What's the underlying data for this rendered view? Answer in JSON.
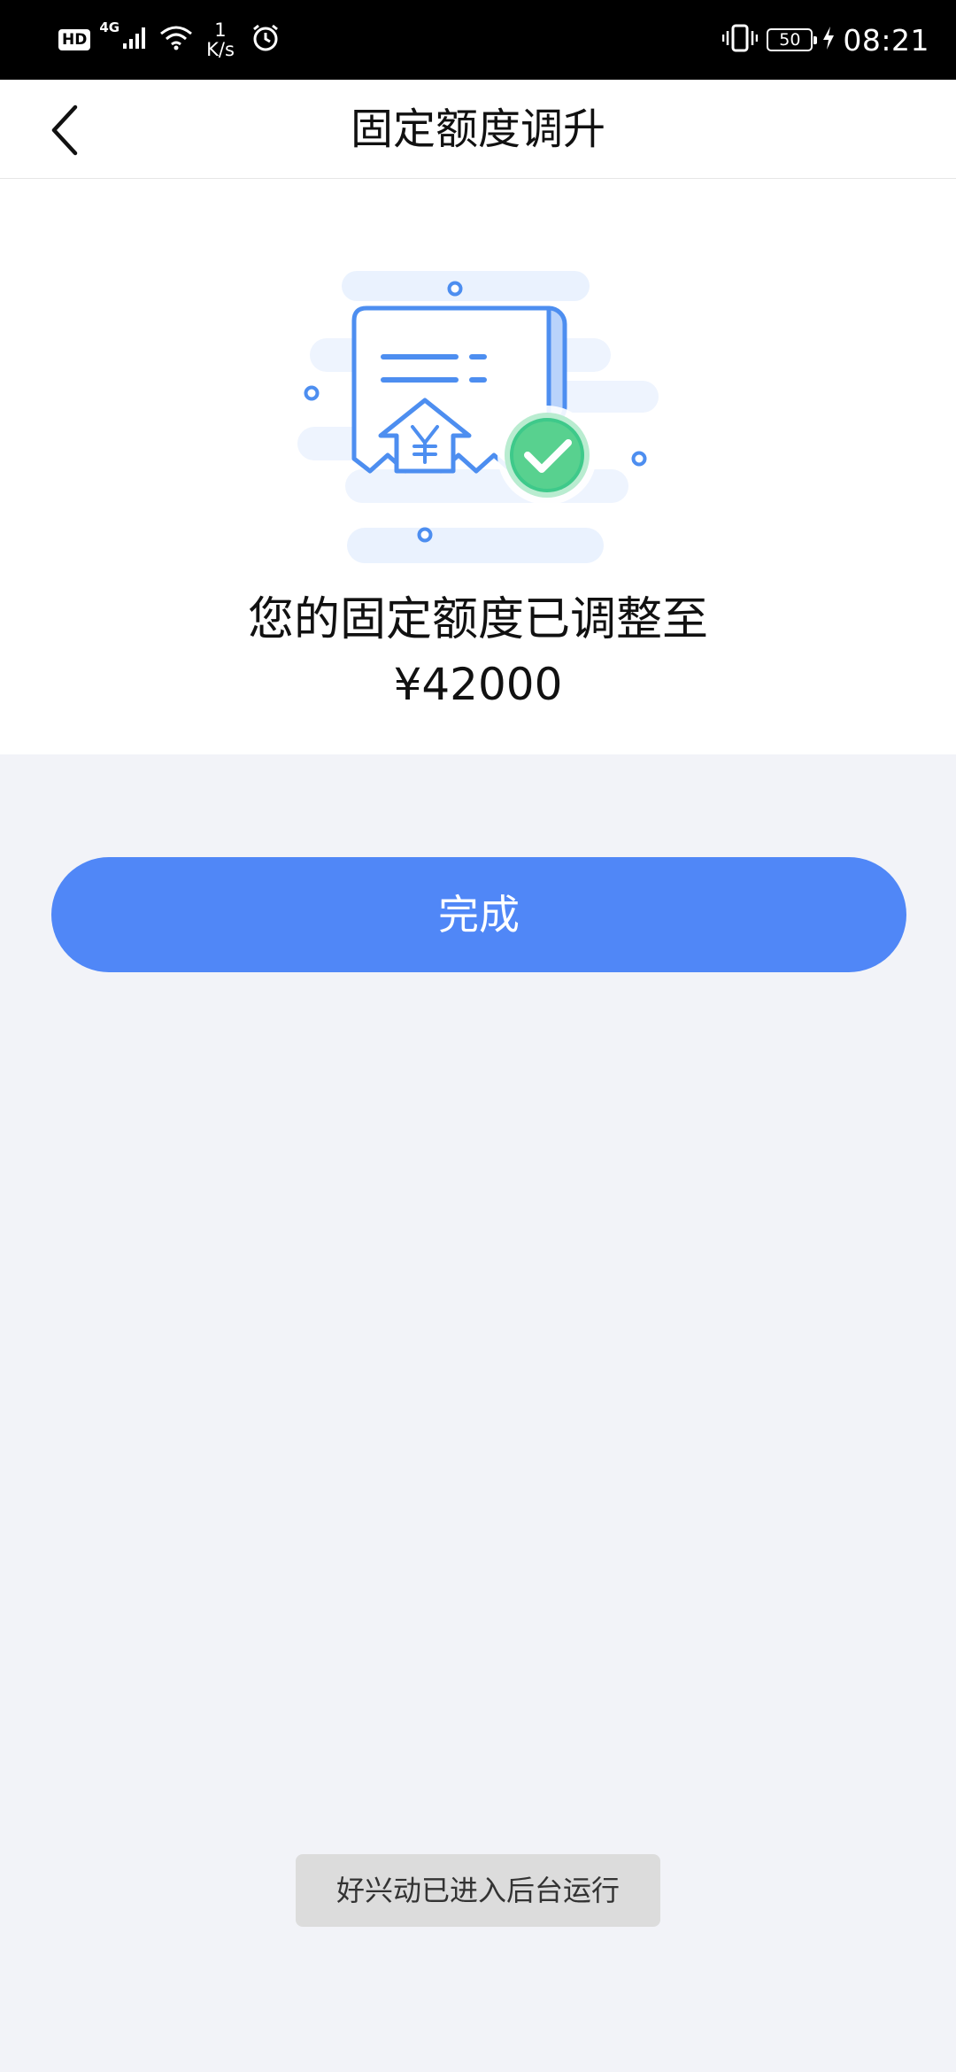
{
  "status_bar": {
    "hd": "HD",
    "network": "4G",
    "speed_value": "1",
    "speed_unit": "K/s",
    "battery": "50",
    "time": "08:21"
  },
  "nav": {
    "title": "固定额度调升"
  },
  "result": {
    "message": "您的固定额度已调整至",
    "amount": "¥42000"
  },
  "actions": {
    "done_label": "完成"
  },
  "toast": {
    "text": "好兴动已进入后台运行"
  },
  "colors": {
    "accent": "#5087f7",
    "success": "#3ec98a",
    "background": "#f2f3f8"
  },
  "icons": [
    "back-arrow-icon",
    "signal-icon",
    "wifi-icon",
    "alarm-icon",
    "vibrate-icon",
    "battery-icon",
    "charging-icon",
    "receipt-success-illustration"
  ]
}
